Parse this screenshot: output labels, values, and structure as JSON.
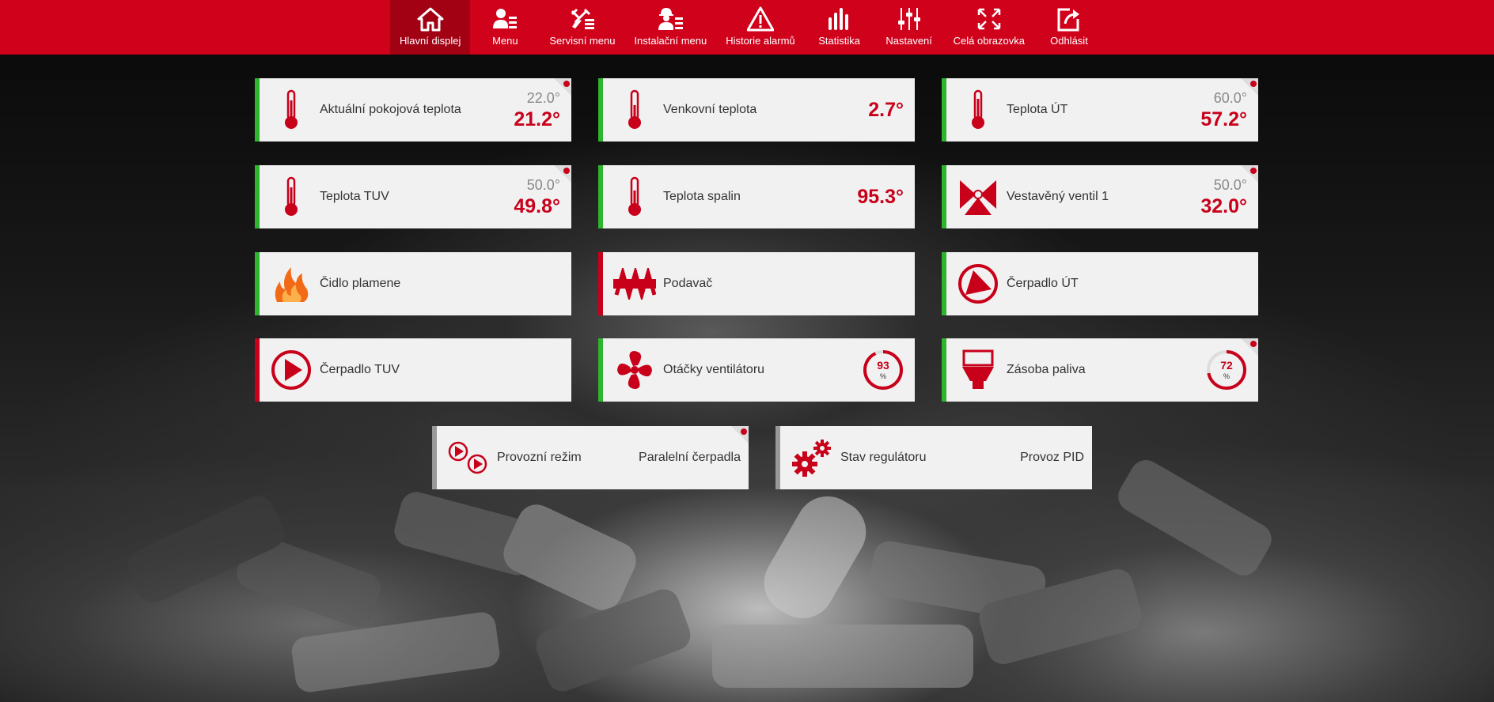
{
  "nav": [
    {
      "label": "Hlavní displej",
      "icon": "home-icon",
      "active": true
    },
    {
      "label": "Menu",
      "icon": "user-list-icon"
    },
    {
      "label": "Servisní menu",
      "icon": "tools-icon"
    },
    {
      "label": "Instalační menu",
      "icon": "worker-icon"
    },
    {
      "label": "Historie alarmů",
      "icon": "warning-icon"
    },
    {
      "label": "Statistika",
      "icon": "bars-icon"
    },
    {
      "label": "Nastavení",
      "icon": "sliders-icon"
    },
    {
      "label": "Celá obrazovka",
      "icon": "fullscreen-icon"
    },
    {
      "label": "Odhlásit",
      "icon": "logout-icon"
    }
  ],
  "tiles": {
    "room_temp": {
      "label": "Aktuální pokojová teplota",
      "set": "22.0°",
      "value": "21.2°",
      "icon": "thermometer-icon"
    },
    "outdoor_temp": {
      "label": "Venkovní teplota",
      "value": "2.7°",
      "icon": "thermometer-icon"
    },
    "ut_temp": {
      "label": "Teplota ÚT",
      "set": "60.0°",
      "value": "57.2°",
      "icon": "thermometer-icon"
    },
    "tuv_temp": {
      "label": "Teplota TUV",
      "set": "50.0°",
      "value": "49.8°",
      "icon": "thermometer-icon"
    },
    "flue_temp": {
      "label": "Teplota spalin",
      "value": "95.3°",
      "icon": "thermometer-icon"
    },
    "valve": {
      "label": "Vestavěný ventil 1",
      "set": "50.0°",
      "value": "32.0°",
      "icon": "valve-icon"
    },
    "flame": {
      "label": "Čidlo plamene",
      "icon": "flame-icon"
    },
    "feeder": {
      "label": "Podavač",
      "icon": "feeder-icon"
    },
    "pump_ut": {
      "label": "Čerpadlo ÚT",
      "icon": "pump-icon"
    },
    "pump_tuv": {
      "label": "Čerpadlo TUV",
      "icon": "pump-play-icon"
    },
    "fan": {
      "label": "Otáčky ventilátoru",
      "gauge": "93",
      "unit": "%",
      "level": 0.93,
      "icon": "fan-icon"
    },
    "fuel": {
      "label": "Zásoba paliva",
      "gauge": "72",
      "unit": "%",
      "level": 0.72,
      "icon": "hopper-icon"
    },
    "mode": {
      "label": "Provozní režim",
      "value": "Paralelní čerpadla",
      "icon": "dual-pump-icon"
    },
    "status": {
      "label": "Stav regulátoru",
      "value": "Provoz PID",
      "icon": "gears-icon"
    }
  },
  "colors": {
    "accent": "#d0011b",
    "ok": "#2db52d",
    "off": "#c8001a",
    "tile": "#f1f1f1"
  }
}
